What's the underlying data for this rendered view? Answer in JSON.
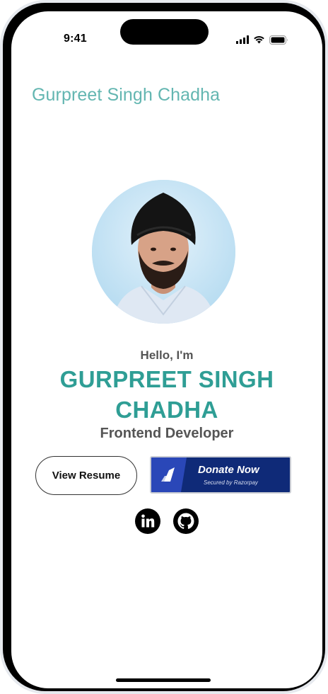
{
  "status_bar": {
    "time": "9:41",
    "icons": [
      "cellular-signal-icon",
      "wifi-icon",
      "battery-icon"
    ]
  },
  "header": {
    "brand_title": "Gurpreet Singh Chadha"
  },
  "hero": {
    "greeting": "Hello, I'm",
    "name": "GURPREET SINGH CHADHA",
    "role": "Frontend Developer"
  },
  "actions": {
    "resume_label": "View Resume",
    "donate": {
      "title": "Donate Now",
      "subtitle": "Secured by Razorpay"
    }
  },
  "social": {
    "icons": [
      "linkedin-icon",
      "github-icon"
    ]
  },
  "colors": {
    "accent_teal": "#2f9e95",
    "brand_title": "#63b6b1",
    "donate_bg": "#0f2a78",
    "donate_logo_bg": "#2a47b8",
    "text_gray": "#555555"
  }
}
